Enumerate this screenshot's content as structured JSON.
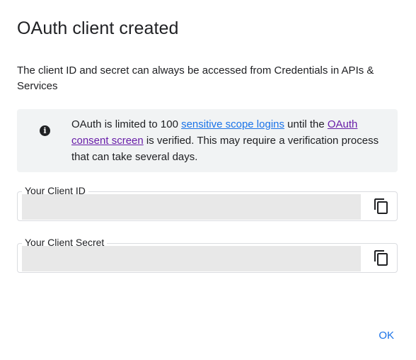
{
  "dialog": {
    "title": "OAuth client created",
    "description": "The client ID and secret can always be accessed from Credentials in APIs & Services",
    "banner": {
      "icon": "info-icon",
      "text_before": "OAuth is limited to 100 ",
      "link1": "sensitive scope logins",
      "text_middle": " until the ",
      "link2": "OAuth consent screen",
      "text_after": " is verified. This may require a verification process that can take several days."
    },
    "client_id": {
      "label": "Your Client ID",
      "copy_icon": "copy-icon"
    },
    "client_secret": {
      "label": "Your Client Secret",
      "copy_icon": "copy-icon"
    },
    "ok_label": "OK"
  },
  "colors": {
    "link": "#1a73e8",
    "link_visited": "#681da8",
    "banner_bg": "#f1f3f4",
    "redacted": "#e8e8e8"
  }
}
